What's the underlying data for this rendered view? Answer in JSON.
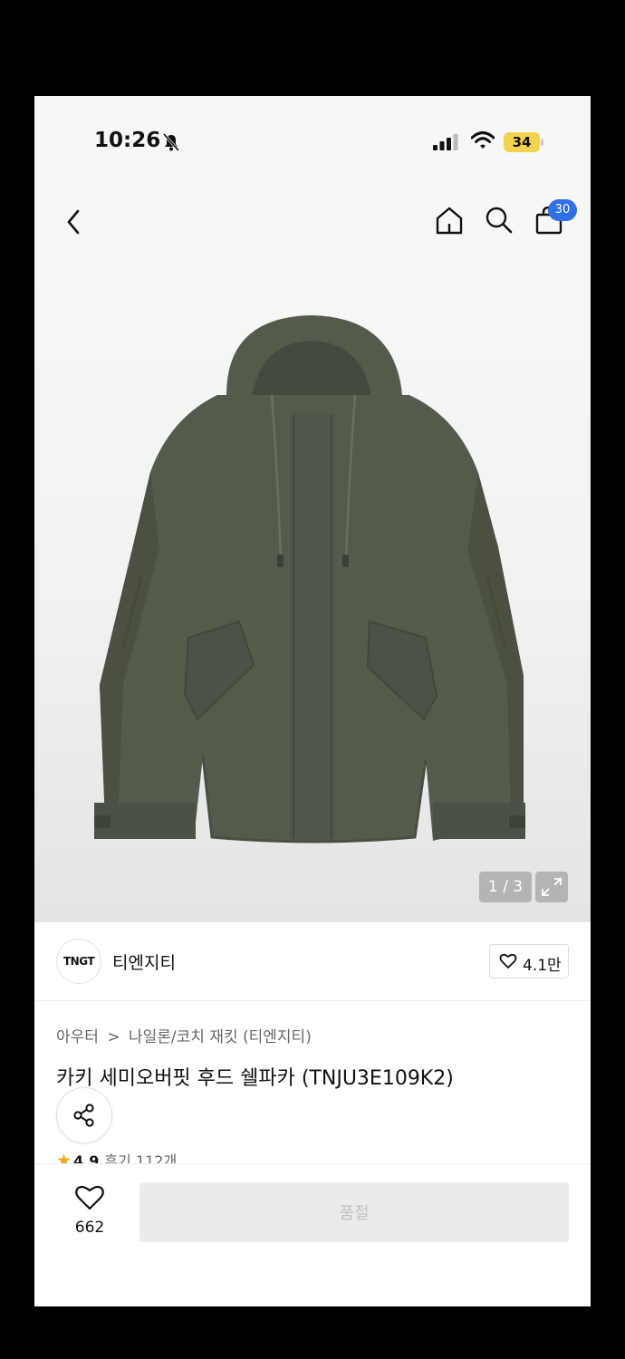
{
  "status_bar": {
    "time": "10:26",
    "battery": "34"
  },
  "nav": {
    "cart_count": "30",
    "icons": [
      "back-icon",
      "home-icon",
      "search-icon",
      "shopping-bag-icon"
    ]
  },
  "image": {
    "counter": "1 / 3",
    "jacket_color": "#545a4c"
  },
  "brand": {
    "logo_text": "TNGT",
    "name": "티엔지티",
    "likes": "4.1만"
  },
  "breadcrumb": {
    "category": "아우터",
    "separator": ">",
    "subcategory": "나일론/코치 재킷 (티엔지티)"
  },
  "product": {
    "title": "카키 세미오버핏 후드 쉘파카 (TNJU3E109K2)",
    "rating": "4.9",
    "reviews": "후기 112개"
  },
  "bottom_bar": {
    "wish_count": "662",
    "buy_label": "품절"
  },
  "colors": {
    "accent": "#2f6fe8",
    "star": "#f5a623",
    "disabled": "#ebebeb"
  }
}
